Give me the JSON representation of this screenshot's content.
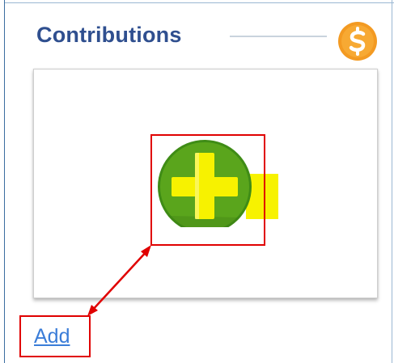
{
  "panel": {
    "title": "Contributions",
    "title_icon": "dollar-coin-icon",
    "action_icon": "add-circle-icon",
    "add_link_label": "Add"
  },
  "colors": {
    "title_text": "#2f4f8f",
    "coin_orange": "#f39a22",
    "add_green": "#5aa51c",
    "plus_yellow": "#f7f200",
    "highlight_red": "#e00000",
    "link_blue": "#3b7dd8"
  }
}
